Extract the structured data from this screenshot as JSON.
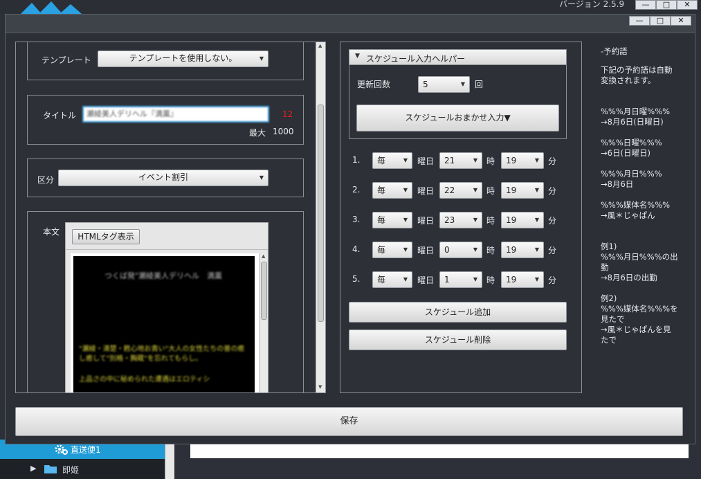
{
  "app": {
    "version": "バージョン 2.5.9",
    "win_buttons": [
      "—",
      "□",
      "✕"
    ],
    "tree": {
      "item1": "直送便1",
      "item2": "即姫"
    }
  },
  "dialog": {
    "win_buttons": [
      "—",
      "□",
      "✕"
    ],
    "left": {
      "template_label": "テンプレート",
      "template_value": "テンプレートを使用しない。",
      "title_label": "タイトル",
      "title_value": "瀬綾美人デリヘル『満薫』",
      "title_count": "12",
      "max_label": "最大",
      "max_value": "1000",
      "kubun_label": "区分",
      "kubun_value": "イベント割引",
      "honbun_label": "本文",
      "html_button": "HTMLタグ表示",
      "body_text_1": "つくば発\"瀬綾美人デリヘル　満薫",
      "body_text_2": "\"瀬綾・清楚・甦心地お貴い\"大人の女性たちの普の癒し癒して\"別格・胸蔵\"を忘れてもらし。",
      "body_text_3": "上品さの中に秘められた遭遇はエロティシ"
    },
    "helper": {
      "header": "スケジュール入力ヘルパー",
      "count_label": "更新回数",
      "count_value": "5",
      "count_unit": "回",
      "auto_button": "スケジュールおまかせ入力▼"
    },
    "schedule": {
      "rows": [
        {
          "num": "1.",
          "day": "毎",
          "day_unit": "曜日",
          "hour": "21",
          "hour_unit": "時",
          "min": "19",
          "min_unit": "分"
        },
        {
          "num": "2.",
          "day": "毎",
          "day_unit": "曜日",
          "hour": "22",
          "hour_unit": "時",
          "min": "19",
          "min_unit": "分"
        },
        {
          "num": "3.",
          "day": "毎",
          "day_unit": "曜日",
          "hour": "23",
          "hour_unit": "時",
          "min": "19",
          "min_unit": "分"
        },
        {
          "num": "4.",
          "day": "毎",
          "day_unit": "曜日",
          "hour": "0",
          "hour_unit": "時",
          "min": "19",
          "min_unit": "分"
        },
        {
          "num": "5.",
          "day": "毎",
          "day_unit": "曜日",
          "hour": "1",
          "hour_unit": "時",
          "min": "19",
          "min_unit": "分"
        }
      ],
      "add_button": "スケジュール追加",
      "delete_button": "スケジュール削除"
    },
    "reserved": {
      "title": "-予約語",
      "lines": [
        "下記の予約語は自動",
        "変換されます。",
        "%%%月日曜%%%",
        "→8月6日(日曜日)",
        "%%%日曜%%%",
        "→6日(日曜日)",
        "%%%月日%%%",
        "→8月6日",
        "%%%媒体名%%%",
        "→風＊じゃぱん",
        "例1)",
        "%%%月日%%%の出",
        "勤",
        "→8月6日の出勤",
        "例2)",
        "%%%媒体名%%%を",
        "見たで",
        "→風＊じゃぱんを見",
        "たで"
      ]
    },
    "save_button": "保存"
  },
  "colors": {
    "accent_blue": "#1f9bd6",
    "counter_red": "#e02020"
  }
}
